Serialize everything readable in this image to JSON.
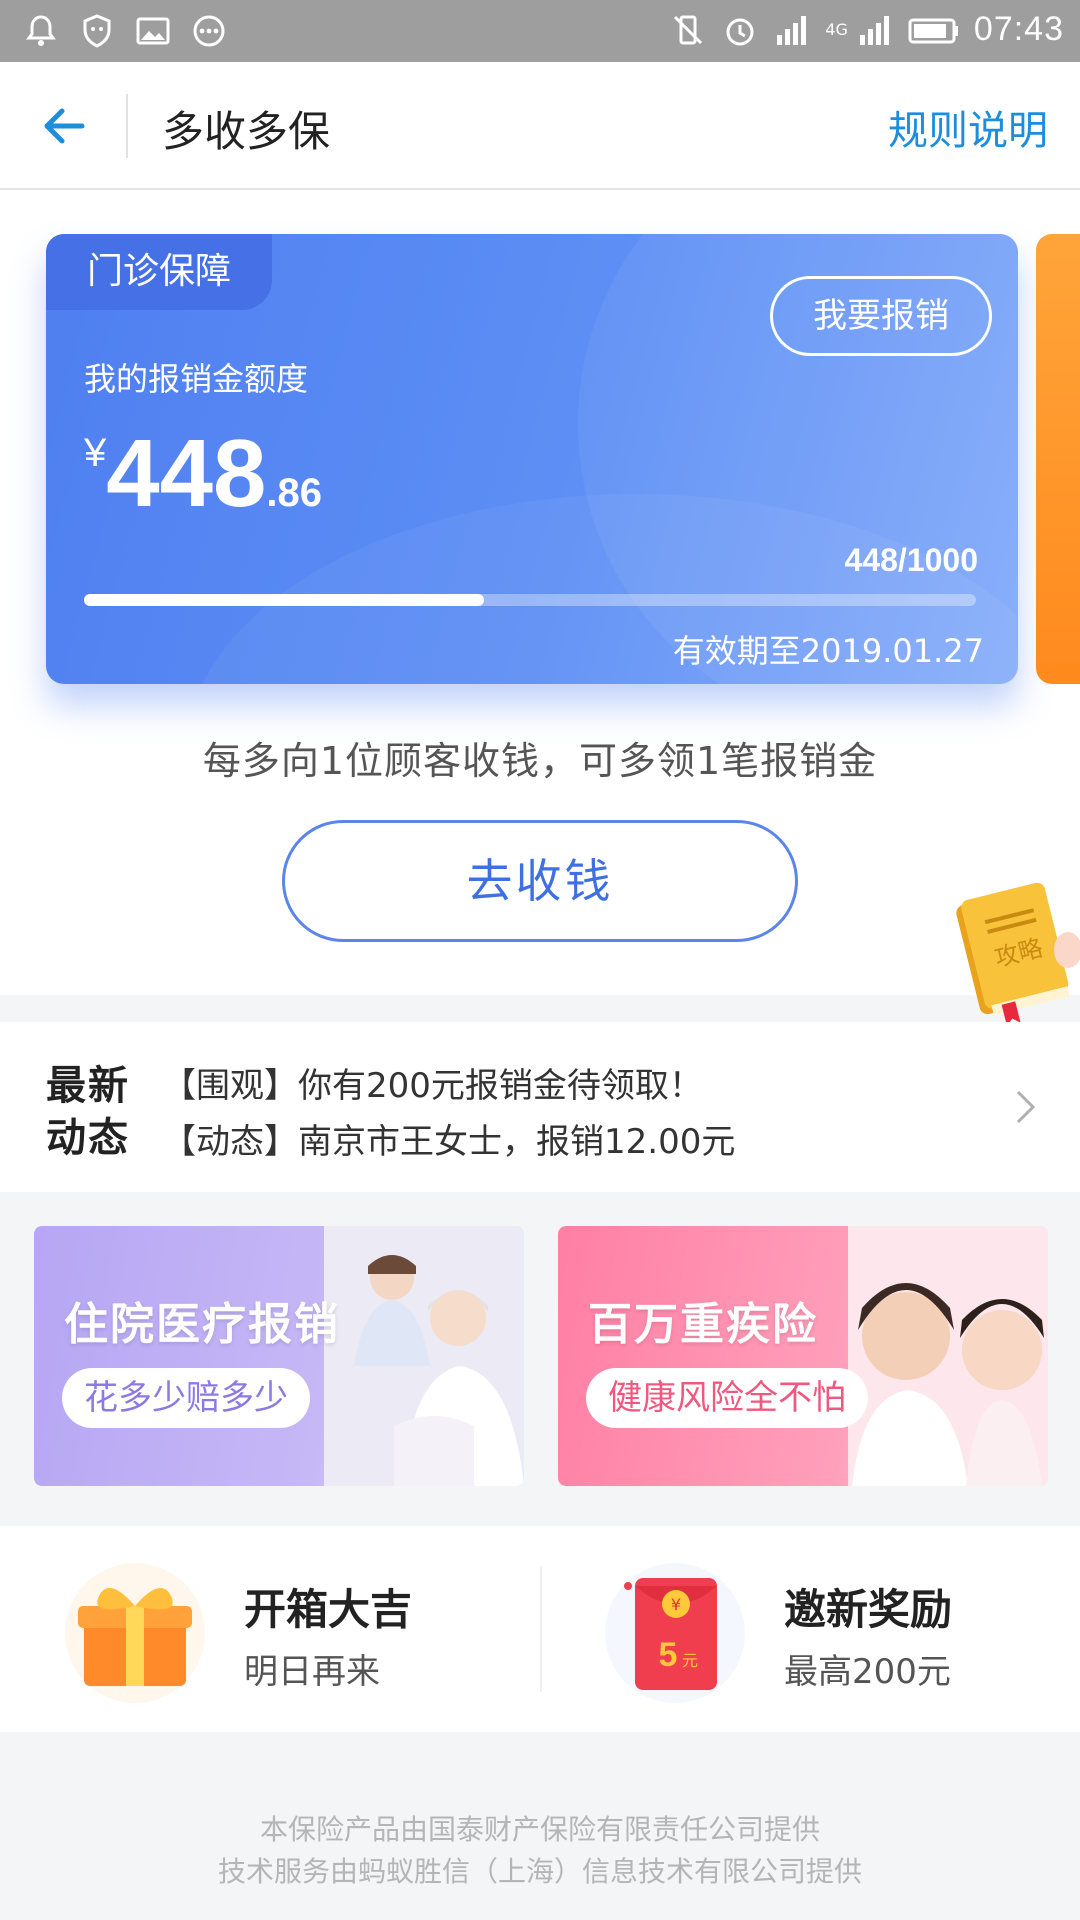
{
  "status_bar": {
    "time": "07:43",
    "network": "4G"
  },
  "header": {
    "title": "多收多保",
    "rules_label": "规则说明"
  },
  "card": {
    "tag": "门诊保障",
    "claim_button": "我要报销",
    "quota_label": "我的报销金额度",
    "currency": "¥",
    "amount_int": "448",
    "amount_dec": ".86",
    "progress_text": "448/1000",
    "progress_fraction": 0.448,
    "validity": "有效期至2019.01.27",
    "accent": "#5b8cf3"
  },
  "promo": {
    "text": "每多向1位顾客收钱，可多领1笔报销金",
    "collect_button": "去收钱"
  },
  "guide": {
    "label": "攻略"
  },
  "news": {
    "logo_line1": "最新",
    "logo_line2": "动态",
    "items": [
      "【围观】你有200元报销金待领取！",
      "【动态】南京市王女士，报销12.00元"
    ]
  },
  "banners": [
    {
      "title": "住院医疗报销",
      "subtitle": "花多少赔多少"
    },
    {
      "title": "百万重疾险",
      "subtitle": "健康风险全不怕"
    }
  ],
  "features": [
    {
      "title": "开箱大吉",
      "subtitle": "明日再来",
      "icon": "gift-icon"
    },
    {
      "title": "邀新奖励",
      "subtitle": "最高200元",
      "icon": "red-envelope-icon",
      "badge": "5",
      "badge_unit": "元",
      "badge_symbol": "¥"
    }
  ],
  "footer": {
    "line1": "本保险产品由国泰财产保险有限责任公司提供",
    "line2": "技术服务由蚂蚁胜信（上海）信息技术有限公司提供"
  }
}
